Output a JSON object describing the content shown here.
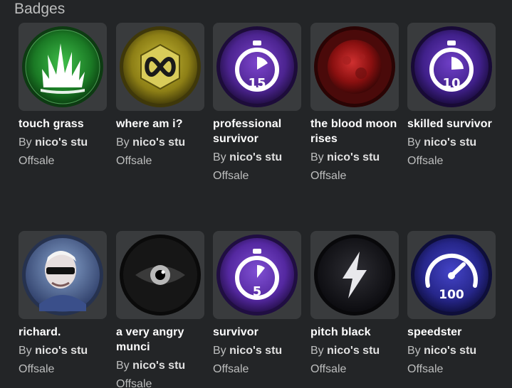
{
  "section": {
    "title": "Badges"
  },
  "badges": [
    {
      "name": "touch grass",
      "by_label": "By",
      "creator": "nico's stu",
      "price": "Offsale",
      "icon": "grass-icon"
    },
    {
      "name": "where am i?",
      "by_label": "By",
      "creator": "nico's stu",
      "price": "Offsale",
      "icon": "infinity-icon"
    },
    {
      "name": "professional survivor",
      "by_label": "By",
      "creator": "nico's stu",
      "price": "Offsale",
      "icon": "stopwatch-icon",
      "icon_text": "15"
    },
    {
      "name": "the blood moon rises",
      "by_label": "By",
      "creator": "nico's stu",
      "price": "Offsale",
      "icon": "blood-moon-icon"
    },
    {
      "name": "skilled survivor",
      "by_label": "By",
      "creator": "nico's stu",
      "price": "Offsale",
      "icon": "stopwatch-icon",
      "icon_text": "10"
    },
    {
      "name": "richard.",
      "by_label": "By",
      "creator": "nico's stu",
      "price": "Offsale",
      "icon": "man-with-sunglasses-icon"
    },
    {
      "name": "a very angry munci",
      "by_label": "By",
      "creator": "nico's stu",
      "price": "Offsale",
      "icon": "eye-icon"
    },
    {
      "name": "survivor",
      "by_label": "By",
      "creator": "nico's stu",
      "price": "Offsale",
      "icon": "stopwatch-icon",
      "icon_text": "5"
    },
    {
      "name": "pitch black",
      "by_label": "By",
      "creator": "nico's stu",
      "price": "Offsale",
      "icon": "lightning-icon"
    },
    {
      "name": "speedster",
      "by_label": "By",
      "creator": "nico's stu",
      "price": "Offsale",
      "icon": "speedometer-icon",
      "icon_text": "100"
    }
  ],
  "colors": {
    "background": "#232527",
    "card_frame": "#393b3d",
    "title": "#bdbebe",
    "badge_name": "#ffffff",
    "secondary_text": "#bdbebe",
    "creator_link": "#e1e1e1",
    "grass_badge": "#1e8a2a",
    "gold_badge": "#a89a1e",
    "purple_badge": "#5a2a9e",
    "blood_badge": "#a01818",
    "blue_badge": "#2a2a8e"
  }
}
